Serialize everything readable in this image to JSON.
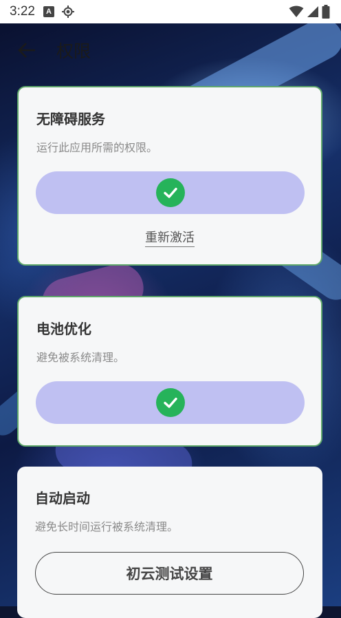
{
  "status_bar": {
    "time": "3:22",
    "notif_icon_letter": "A"
  },
  "app_bar": {
    "title": "权限"
  },
  "cards": [
    {
      "title": "无障碍服务",
      "description": "运行此应用所需的权限。",
      "status": "granted",
      "link": "重新激活"
    },
    {
      "title": "电池优化",
      "description": "避免被系统清理。",
      "status": "granted"
    },
    {
      "title": "自动启动",
      "description": "避免长时间运行被系统清理。",
      "button": "初云测试设置"
    }
  ],
  "colors": {
    "granted_pill": "#bfc0f2",
    "check_green": "#26b35a",
    "card_border": "#5fa86a"
  }
}
